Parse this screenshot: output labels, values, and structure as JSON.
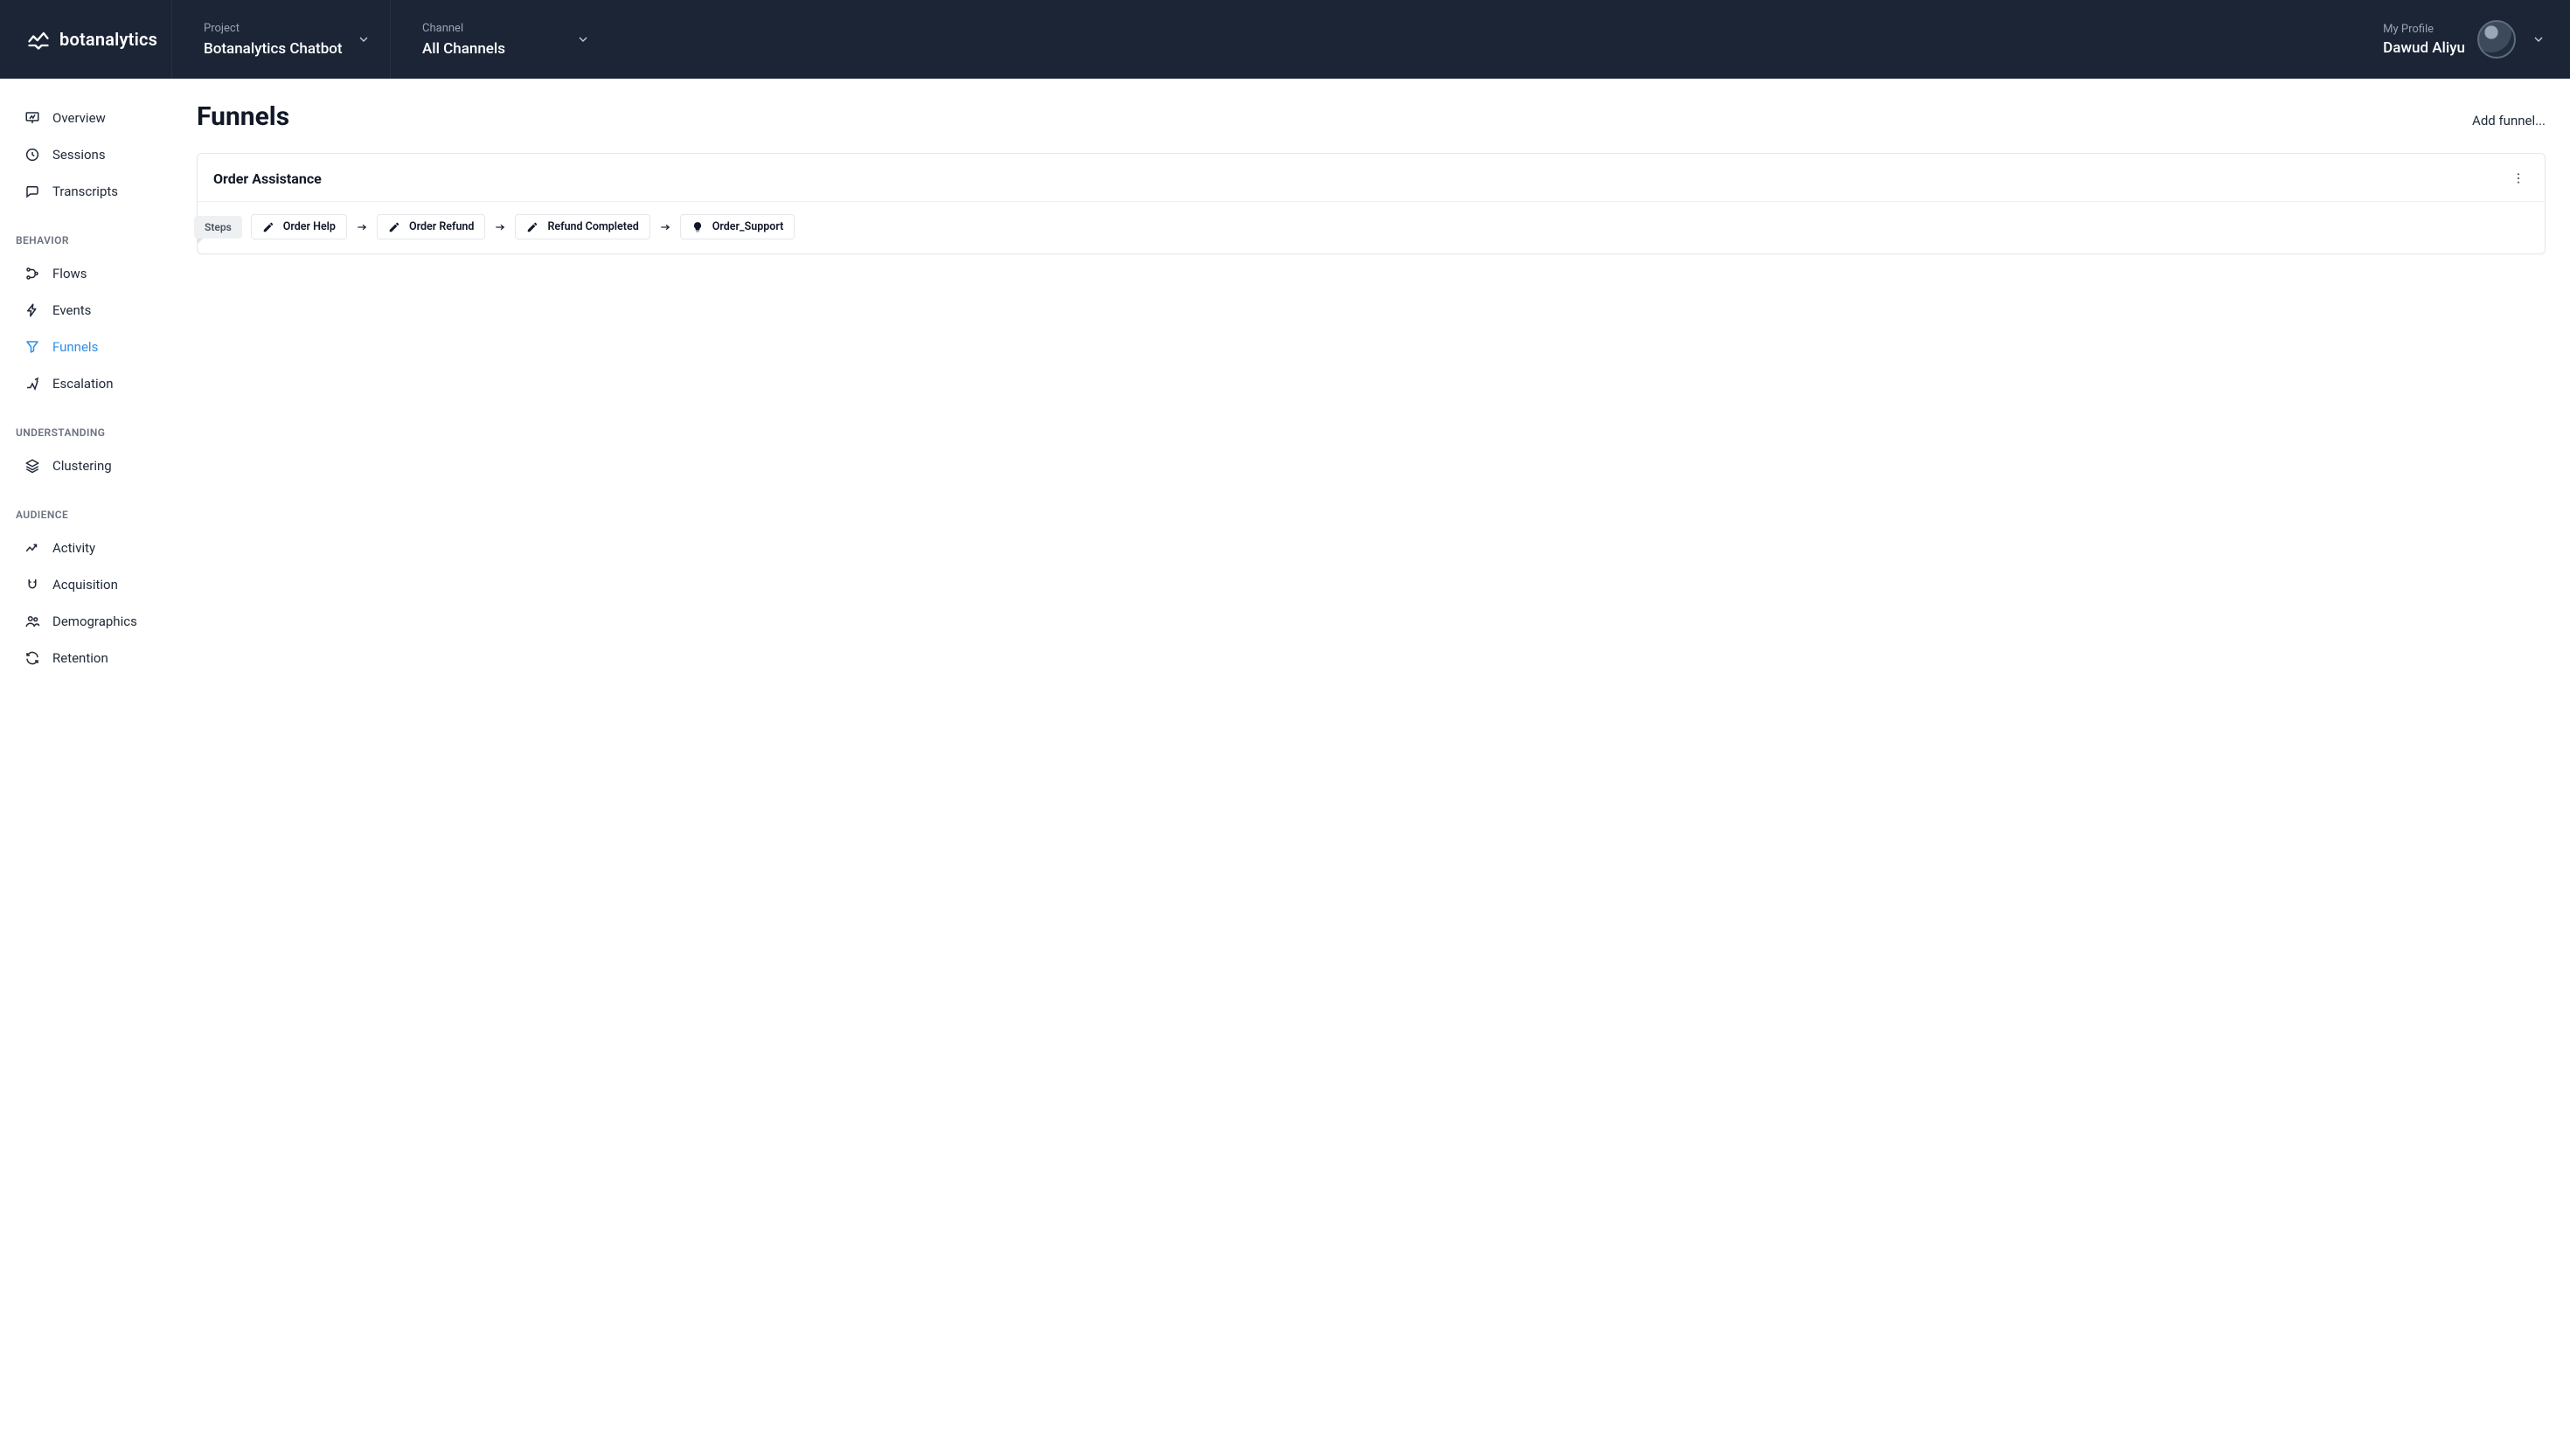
{
  "brand": {
    "name": "botanalytics"
  },
  "header": {
    "project": {
      "label": "Project",
      "value": "Botanalytics Chatbot"
    },
    "channel": {
      "label": "Channel",
      "value": "All Channels"
    },
    "profile": {
      "label": "My Profile",
      "value": "Dawud Aliyu"
    }
  },
  "sidebar": {
    "top": [
      {
        "label": "Overview",
        "icon": "overview"
      },
      {
        "label": "Sessions",
        "icon": "clock"
      },
      {
        "label": "Transcripts",
        "icon": "chat"
      }
    ],
    "sections": [
      {
        "title": "BEHAVIOR",
        "items": [
          {
            "label": "Flows",
            "icon": "flows"
          },
          {
            "label": "Events",
            "icon": "bolt"
          },
          {
            "label": "Funnels",
            "icon": "funnel",
            "active": true
          },
          {
            "label": "Escalation",
            "icon": "escalation"
          }
        ]
      },
      {
        "title": "UNDERSTANDING",
        "items": [
          {
            "label": "Clustering",
            "icon": "layers"
          }
        ]
      },
      {
        "title": "AUDIENCE",
        "items": [
          {
            "label": "Activity",
            "icon": "trend"
          },
          {
            "label": "Acquisition",
            "icon": "magnet"
          },
          {
            "label": "Demographics",
            "icon": "people"
          },
          {
            "label": "Retention",
            "icon": "refresh"
          }
        ]
      }
    ]
  },
  "page": {
    "title": "Funnels",
    "add_funnel": "Add funnel..."
  },
  "funnel": {
    "title": "Order Assistance",
    "steps_label": "Steps",
    "steps": [
      {
        "label": "Order Help",
        "icon": "pencil"
      },
      {
        "label": "Order Refund",
        "icon": "pencil"
      },
      {
        "label": "Refund Completed",
        "icon": "pencil"
      },
      {
        "label": "Order_Support",
        "icon": "bulb"
      }
    ]
  }
}
